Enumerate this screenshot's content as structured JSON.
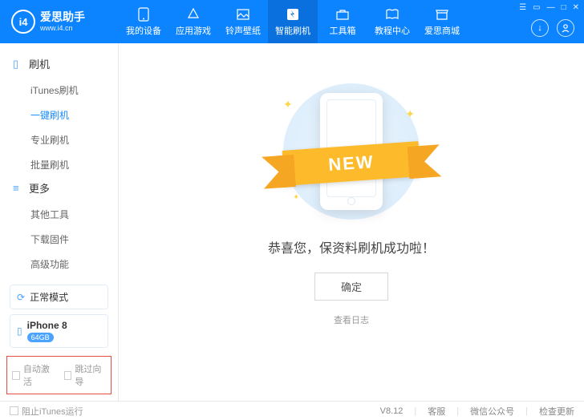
{
  "logo": {
    "mark": "i4",
    "title": "爱思助手",
    "sub": "www.i4.cn"
  },
  "tabs": [
    {
      "label": "我的设备"
    },
    {
      "label": "应用游戏"
    },
    {
      "label": "铃声壁纸"
    },
    {
      "label": "智能刷机"
    },
    {
      "label": "工具箱"
    },
    {
      "label": "教程中心"
    },
    {
      "label": "爱思商城"
    }
  ],
  "side": {
    "sec1": "刷机",
    "items1": [
      "iTunes刷机",
      "一键刷机",
      "专业刷机",
      "批量刷机"
    ],
    "sec2": "更多",
    "items2": [
      "其他工具",
      "下载固件",
      "高级功能"
    ]
  },
  "device": {
    "mode": "正常模式",
    "name": "iPhone 8",
    "storage": "64GB"
  },
  "opts": {
    "a": "自动激活",
    "b": "跳过向导"
  },
  "main": {
    "ribbon": "NEW",
    "message": "恭喜您，保资料刷机成功啦！",
    "ok": "确定",
    "log": "查看日志"
  },
  "footer": {
    "block": "阻止iTunes运行",
    "ver": "V8.12",
    "a": "客服",
    "b": "微信公众号",
    "c": "检查更新"
  }
}
